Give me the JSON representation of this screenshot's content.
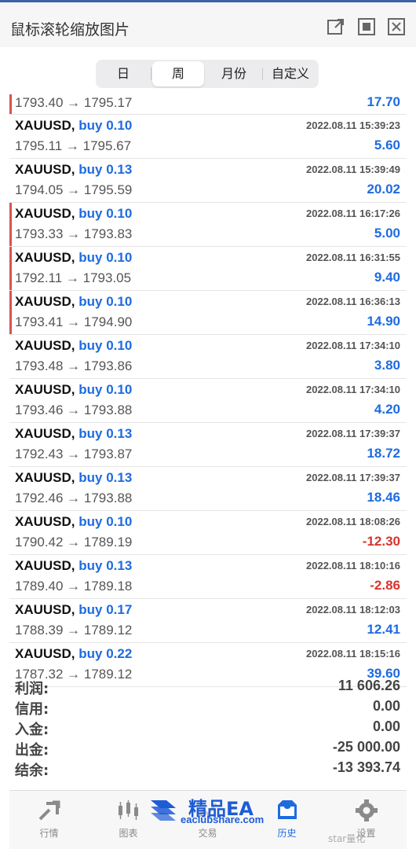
{
  "window": {
    "title": "鼠标滚轮缩放图片",
    "buttons": [
      "popout-icon",
      "fullscreen-icon",
      "close-icon"
    ]
  },
  "period_tabs": [
    {
      "label": "日",
      "active": false
    },
    {
      "label": "周",
      "active": true
    },
    {
      "label": "月份",
      "active": false
    },
    {
      "label": "自定义",
      "active": false
    }
  ],
  "deals": [
    {
      "symbol": "",
      "side": "",
      "time": "",
      "prices": "1793.40 → 1795.17",
      "profit": "17.70",
      "marker": true
    },
    {
      "symbol": "XAUUSD,",
      "side": "buy 0.10",
      "time": "2022.08.11 15:39:23",
      "prices": "1795.11 → 1795.67",
      "profit": "5.60",
      "marker": false
    },
    {
      "symbol": "XAUUSD,",
      "side": "buy 0.13",
      "time": "2022.08.11 15:39:49",
      "prices": "1794.05 → 1795.59",
      "profit": "20.02",
      "marker": false
    },
    {
      "symbol": "XAUUSD,",
      "side": "buy 0.10",
      "time": "2022.08.11 16:17:26",
      "prices": "1793.33 → 1793.83",
      "profit": "5.00",
      "marker": true
    },
    {
      "symbol": "XAUUSD,",
      "side": "buy 0.10",
      "time": "2022.08.11 16:31:55",
      "prices": "1792.11 → 1793.05",
      "profit": "9.40",
      "marker": true
    },
    {
      "symbol": "XAUUSD,",
      "side": "buy 0.10",
      "time": "2022.08.11 16:36:13",
      "prices": "1793.41 → 1794.90",
      "profit": "14.90",
      "marker": true
    },
    {
      "symbol": "XAUUSD,",
      "side": "buy 0.10",
      "time": "2022.08.11 17:34:10",
      "prices": "1793.48 → 1793.86",
      "profit": "3.80",
      "marker": false
    },
    {
      "symbol": "XAUUSD,",
      "side": "buy 0.10",
      "time": "2022.08.11 17:34:10",
      "prices": "1793.46 → 1793.88",
      "profit": "4.20",
      "marker": false
    },
    {
      "symbol": "XAUUSD,",
      "side": "buy 0.13",
      "time": "2022.08.11 17:39:37",
      "prices": "1792.43 → 1793.87",
      "profit": "18.72",
      "marker": false
    },
    {
      "symbol": "XAUUSD,",
      "side": "buy 0.13",
      "time": "2022.08.11 17:39:37",
      "prices": "1792.46 → 1793.88",
      "profit": "18.46",
      "marker": false
    },
    {
      "symbol": "XAUUSD,",
      "side": "buy 0.10",
      "time": "2022.08.11 18:08:26",
      "prices": "1790.42 → 1789.19",
      "profit": "-12.30",
      "marker": false
    },
    {
      "symbol": "XAUUSD,",
      "side": "buy 0.13",
      "time": "2022.08.11 18:10:16",
      "prices": "1789.40 → 1789.18",
      "profit": "-2.86",
      "marker": false
    },
    {
      "symbol": "XAUUSD,",
      "side": "buy 0.17",
      "time": "2022.08.11 18:12:03",
      "prices": "1788.39 → 1789.12",
      "profit": "12.41",
      "marker": false
    },
    {
      "symbol": "XAUUSD,",
      "side": "buy 0.22",
      "time": "2022.08.11 18:15:16",
      "prices": "1787.32 → 1789.12",
      "profit": "39.60",
      "marker": false
    }
  ],
  "summary": [
    {
      "label": "利润:",
      "value": "11 606.26"
    },
    {
      "label": "信用:",
      "value": "0.00"
    },
    {
      "label": "入金:",
      "value": "0.00"
    },
    {
      "label": "出金:",
      "value": "-25 000.00"
    },
    {
      "label": "结余:",
      "value": "-13 393.74"
    }
  ],
  "tabbar": [
    {
      "label": "行情",
      "icon": "quotes-icon",
      "active": false
    },
    {
      "label": "图表",
      "icon": "chart-icon",
      "active": false
    },
    {
      "label": "交易",
      "icon": "trade-icon",
      "active": false
    },
    {
      "label": "历史",
      "icon": "history-icon",
      "active": true
    },
    {
      "label": "设置",
      "icon": "settings-icon",
      "active": false
    }
  ],
  "watermark": {
    "text": "精品EA",
    "url": "eaclubshare.com"
  },
  "corner_mark": "star量化",
  "colors": {
    "positive": "#1e6be0",
    "negative": "#d9342b",
    "marker": "#d9534f",
    "accent": "#1e6be0"
  }
}
